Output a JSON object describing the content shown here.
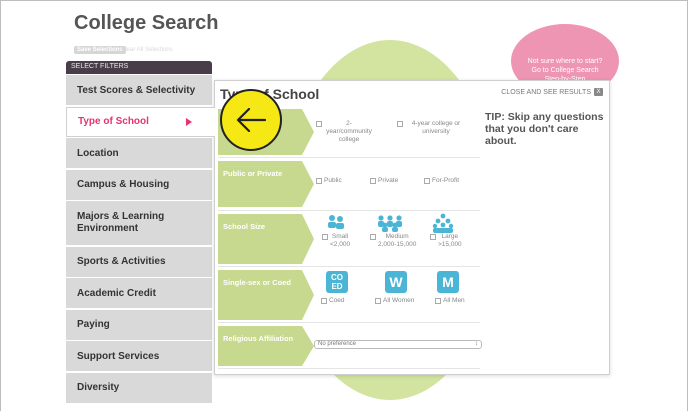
{
  "title": "College Search",
  "save_selections": "Save Selections",
  "clear_all": "Clear All Selections",
  "select_filters": "SELECT FILTERS",
  "filters": [
    "Test Scores & Selectivity",
    "Type of School",
    "Location",
    "Campus & Housing",
    "Majors & Learning Environment",
    "Sports & Activities",
    "Academic Credit",
    "Paying",
    "Support Services",
    "Diversity"
  ],
  "badge": {
    "line1": "Not sure where to start?",
    "line2_prefix": "Go to ",
    "link": "College Search",
    "line3": "Step-by-Step"
  },
  "panel": {
    "title": "Type of School",
    "close": "CLOSE AND SEE RESULTS",
    "close_x": "X",
    "tip": "TIP: Skip any questions that you don't care about.",
    "rows": {
      "degree": {
        "opt1": "2-year/community college",
        "opt2": "4-year college or university"
      },
      "public": {
        "label": "Public or Private",
        "opt1": "Public",
        "opt2": "Private",
        "opt3": "For-Profit"
      },
      "size": {
        "label": "School Size",
        "small": "Small",
        "small_range": "<2,000",
        "medium": "Medium",
        "medium_range": "2,000-15,000",
        "large": "Large",
        "large_range": ">15,000"
      },
      "coed": {
        "label": "Single-sex or Coed",
        "icon_coed_top": "CO",
        "icon_coed_bottom": "ED",
        "icon_women": "W",
        "icon_men": "M",
        "opt1": "Coed",
        "opt2": "All Women",
        "opt3": "All Men"
      },
      "religion": {
        "label": "Religious Affiliation",
        "select_value": "No preference"
      }
    }
  },
  "colors": {
    "accent_pink": "#e8336d",
    "green_label": "#c7d98f",
    "icon_blue": "#4bb5d6",
    "back_yellow": "#f6e814"
  },
  "icons": {
    "back": "arrow-left-icon",
    "active_arrow": "triangle-right-icon"
  }
}
